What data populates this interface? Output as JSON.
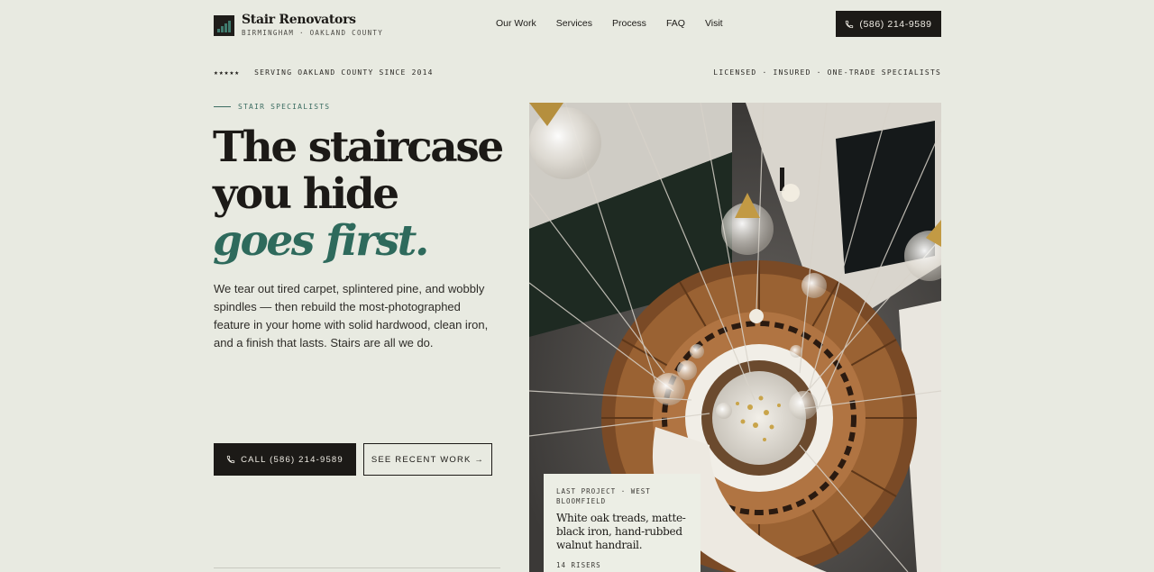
{
  "brand": {
    "name": "Stair Renovators",
    "subtitle": "BIRMINGHAM · OAKLAND COUNTY"
  },
  "nav": {
    "items": [
      {
        "label": "Our Work"
      },
      {
        "label": "Services"
      },
      {
        "label": "Process"
      },
      {
        "label": "FAQ"
      },
      {
        "label": "Visit"
      }
    ],
    "phone_label": "(586) 214-9589"
  },
  "trust_strip": {
    "stars": "★★★★★",
    "left_text": "SERVING OAKLAND COUNTY SINCE 2014",
    "right_text": "LICENSED · INSURED · ONE-TRADE SPECIALISTS"
  },
  "hero": {
    "eyebrow": "STAIR SPECIALISTS",
    "headline_line1": "The staircase",
    "headline_line2": "you hide",
    "headline_accent": "goes first.",
    "lede": "We tear out tired carpet, splintered pine, and wobbly spindles — then rebuild the most-photographed feature in your home with solid hardwood, clean iron, and a finish that lasts. Stairs are all we do.",
    "cta_primary": "CALL (586) 214-9589",
    "cta_secondary": "SEE RECENT WORK →"
  },
  "project_card": {
    "kicker": "LAST PROJECT · WEST BLOOMFIELD",
    "title": "White oak treads, matte-black iron, hand-rubbed walnut handrail.",
    "meta": "14 RISERS"
  },
  "colors": {
    "background": "#e8eae1",
    "ink": "#1c1a17",
    "accent": "#2e6a5c"
  },
  "icons": {
    "phone": "phone-icon",
    "logo": "stair-logo-icon"
  }
}
